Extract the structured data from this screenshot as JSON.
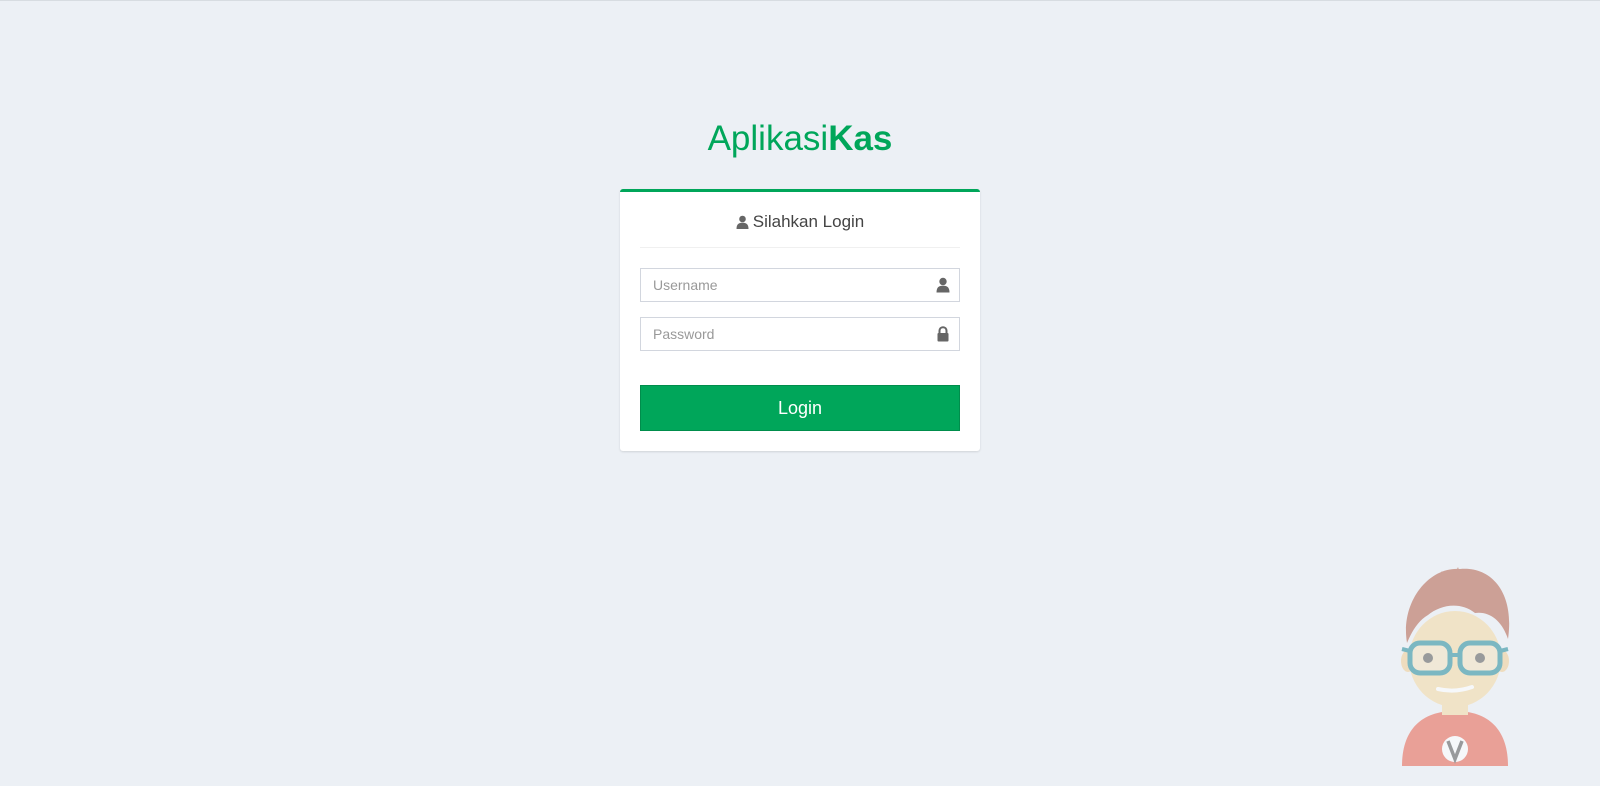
{
  "logo": {
    "light": "Aplikasi",
    "bold": "Kas"
  },
  "login": {
    "title": "Silahkan Login",
    "username_placeholder": "Username",
    "password_placeholder": "Password",
    "button_label": "Login"
  },
  "icons": {
    "title": "user-icon",
    "username": "user-icon",
    "password": "lock-icon",
    "mascot": "mascot-illustration"
  },
  "colors": {
    "accent": "#00a65a",
    "background": "#ecf0f5"
  }
}
